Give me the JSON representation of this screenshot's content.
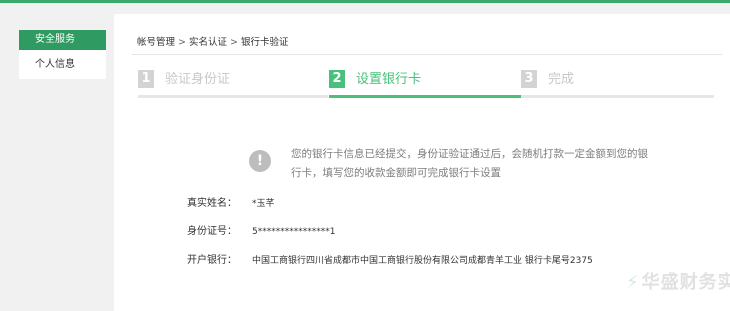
{
  "sidebar": {
    "items": [
      {
        "label": "安全服务",
        "active": true
      },
      {
        "label": "个人信息",
        "active": false
      }
    ]
  },
  "breadcrumb": {
    "items": [
      "帐号管理",
      "实名认证",
      "银行卡验证"
    ],
    "sep": ">"
  },
  "steps": [
    {
      "num": "1",
      "label": "验证身份证",
      "state": "inactive"
    },
    {
      "num": "2",
      "label": "设置银行卡",
      "state": "active"
    },
    {
      "num": "3",
      "label": "完成",
      "state": "inactive"
    }
  ],
  "notice": {
    "text": "您的银行卡信息已经提交，身份证验证通过后，会随机打款一定金额到您的银行卡，填写您的收款金额即可完成银行卡设置"
  },
  "info": {
    "name_label": "真实姓名：",
    "name_value": "*玉芊",
    "id_label": "身份证号：",
    "id_value": "5****************1",
    "bank_label": "开户银行：",
    "bank_value": "中国工商银行四川省成都市中国工商银行股份有限公司成都青羊工业 银行卡尾号2375"
  },
  "watermark": "华盛财务实盾",
  "colors": {
    "brand": "#3aa96b",
    "active_step": "#4bbf7c",
    "inactive_step": "#d3d3d3"
  }
}
